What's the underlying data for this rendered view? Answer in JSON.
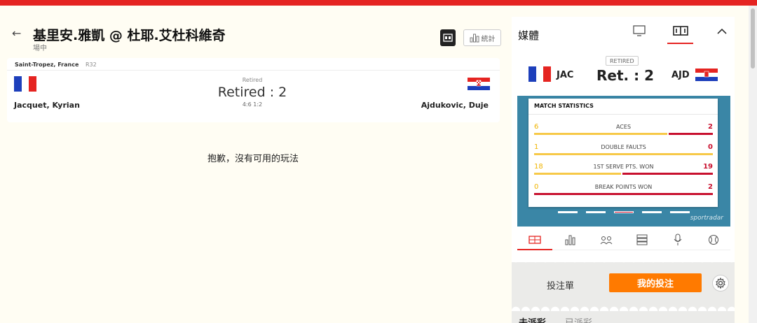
{
  "header": {
    "back_icon": "arrow-left-icon",
    "title": "基里安.雅凱 @ 杜耶.艾杜科維奇",
    "subtitle": "場中",
    "scoreboard_icon": "scoreboard-icon",
    "stats_label": "統計"
  },
  "match": {
    "location": "Saint-Tropez, France",
    "round": "R32",
    "status": "Retired",
    "score": "Retired : 2",
    "sets": "4:6 1:2",
    "player1": "Jacquet, Kyrian",
    "player2": "Ajdukovic, Duje"
  },
  "empty_message": "抱歉，沒有可用的玩法",
  "panel": {
    "title": "媒體",
    "retired_badge": "RETIRED",
    "team1": "JAC",
    "team2": "AJD",
    "score": "Ret. : 2",
    "stats_title": "MATCH STATISTICS",
    "stats": [
      {
        "label": "ACES",
        "v1": "6",
        "v2": "2"
      },
      {
        "label": "DOUBLE FAULTS",
        "v1": "1",
        "v2": "0"
      },
      {
        "label": "1ST SERVE PTS. WON",
        "v1": "18",
        "v2": "19"
      },
      {
        "label": "BREAK POINTS WON",
        "v1": "0",
        "v2": "2"
      }
    ],
    "provider": "sportradar"
  },
  "betslip": {
    "label": "投注單",
    "my_bets": "我的投注",
    "tab_unsettled": "未派彩",
    "tab_settled": "已派彩"
  },
  "colors": {
    "accent": "#e52421",
    "orange": "#ff7a00",
    "home": "#f0b400",
    "away": "#c8102e"
  }
}
